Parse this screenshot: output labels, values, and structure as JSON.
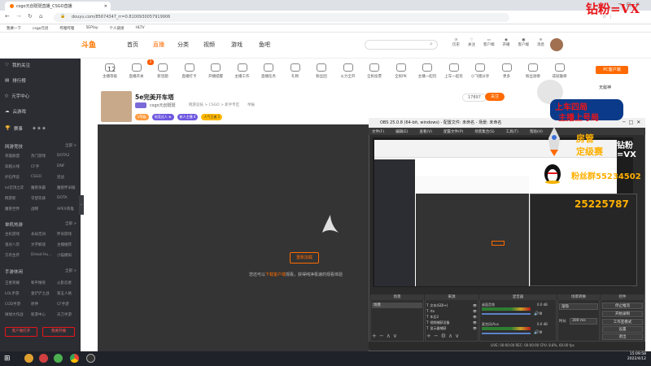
{
  "browser": {
    "tab_title": "csgo元创斑斑直播_CSGO直播",
    "url": "douyu.com/85674347_rr=0.8100930057919906",
    "bookmarks": [
      "我要一下",
      "csgo元创",
      "哔哩哔哩",
      "5EPlay",
      "个人链接",
      "HLTV"
    ]
  },
  "header": {
    "logo": "斗鱼",
    "nav": [
      "首页",
      "直播",
      "分类",
      "视频",
      "游戏",
      "鱼吧"
    ],
    "search_placeholder": "",
    "user_icons": [
      "历史",
      "关注",
      "客户端",
      "开播",
      "客户端",
      "消息"
    ]
  },
  "sidebar": {
    "top_items": [
      "我的关注",
      "排行榜",
      "元宇中心",
      "云游戏",
      "赛事"
    ],
    "sections": [
      {
        "title": "网游竞技",
        "more": "全部 >",
        "items": [
          "英雄联盟",
          "热门游戏",
          "DOTA2",
          "穿越火线",
          "CF手",
          "DNF",
          "炉石传说",
          "CSGO",
          "逆战",
          "lol云顶之弈",
          "魔兽争霸",
          "魔兽怀旧服",
          "网游新",
          "守望先锋",
          "DOTA",
          "魔兽世界",
          "战网",
          "APEX英雄"
        ]
      },
      {
        "title": "单机热游",
        "more": "全部 >",
        "items": [
          "主机游戏",
          "永劫无间",
          "怀旧游戏",
          "鬼谷八荒",
          "文字解谜",
          "主播推荐",
          "方舟生存",
          "Dread Hu...",
          "小猫模拟"
        ]
      },
      {
        "title": "手游休闲",
        "more": "全部 >",
        "items": [
          "王者荣耀",
          "和平精英",
          "火影忍者",
          "LOL手游",
          "金铲铲之战",
          "第五人格",
          "COD手游",
          "原神",
          "CF手游",
          "球球大作战",
          "新游中心",
          "天刀手游"
        ]
      }
    ],
    "btn_client": "客户端打开",
    "btn_live": "我要开播"
  },
  "categories": [
    "主播等级",
    "直播开关",
    "新话题",
    "直播打卡",
    "开播提醒",
    "主播工作",
    "直播任务",
    "礼物",
    "粉丝团",
    "火力全开",
    "全民投票",
    "全民PK",
    "主播一起玩",
    "上车一起玩",
    "小飞猪分享",
    "更多",
    "粉丝勋章",
    "成就徽章"
  ],
  "category_badge_count": "12",
  "category_top_badge": "2",
  "pc_client": "PC客户端",
  "room": {
    "title": "5e完美开车塔",
    "host": "csgo元创斑斑",
    "category": "网游竞技 > CSGO > 新手专区",
    "fans": "95116",
    "subtag": "CSGO新版客",
    "report": "举报",
    "badge_level": "V等级",
    "tags": [
      "电竞达人 ★",
      "新人主播 4",
      "人气王者 1",
      "粉丝勋章 4"
    ],
    "hot_num": "17897",
    "follow_btn": "关注"
  },
  "video": {
    "load_btn": "重新加载",
    "message_pre": "您还可以",
    "message_link": "下载客户端",
    "message_post": "观看，获得纯净极速的观看体验"
  },
  "obs": {
    "title": "OBS 25.0.8 (64-bit, windows) - 配置文件: 未命名 - 场景: 未命名",
    "menu": [
      "文件(F)",
      "编辑(E)",
      "查看(V)",
      "配置文件(P)",
      "场景集合(S)",
      "工具(T)",
      "帮助(H)"
    ],
    "panels": [
      "场景",
      "来源",
      "混音器",
      "场景转换",
      "控件"
    ],
    "scene": "场景",
    "sources": [
      "文本(GDI+)",
      "rtx",
      "车后2",
      "视频捕获设备",
      "显示器捕获"
    ],
    "mixer": [
      {
        "name": "桌面音频",
        "db": "0.0 dB"
      },
      {
        "name": "麦克风/Aux",
        "db": "0.0 dB"
      }
    ],
    "transition": "渐隐",
    "duration_label": "时长",
    "duration": "300 ms",
    "controls": [
      "停止推流",
      "开始录制",
      "工作室模式",
      "设置",
      "退出"
    ],
    "status": "LIVE: 00:00:00   REC: 00:00:00   CPU: 8.8%, 60.00 fps"
  },
  "overlays": {
    "top_right": "钻粉=VX",
    "chat_user": "无敌神",
    "red_lines": [
      "上车四局",
      "主播上号局"
    ],
    "mid_lines": [
      "房管",
      "定级赛"
    ],
    "group_qq": "粉丝群55234502",
    "number": "25225787",
    "vx_label": "钻粉=VX"
  },
  "taskbar": {
    "time": "15:09:58",
    "date": "2022/4/12"
  }
}
